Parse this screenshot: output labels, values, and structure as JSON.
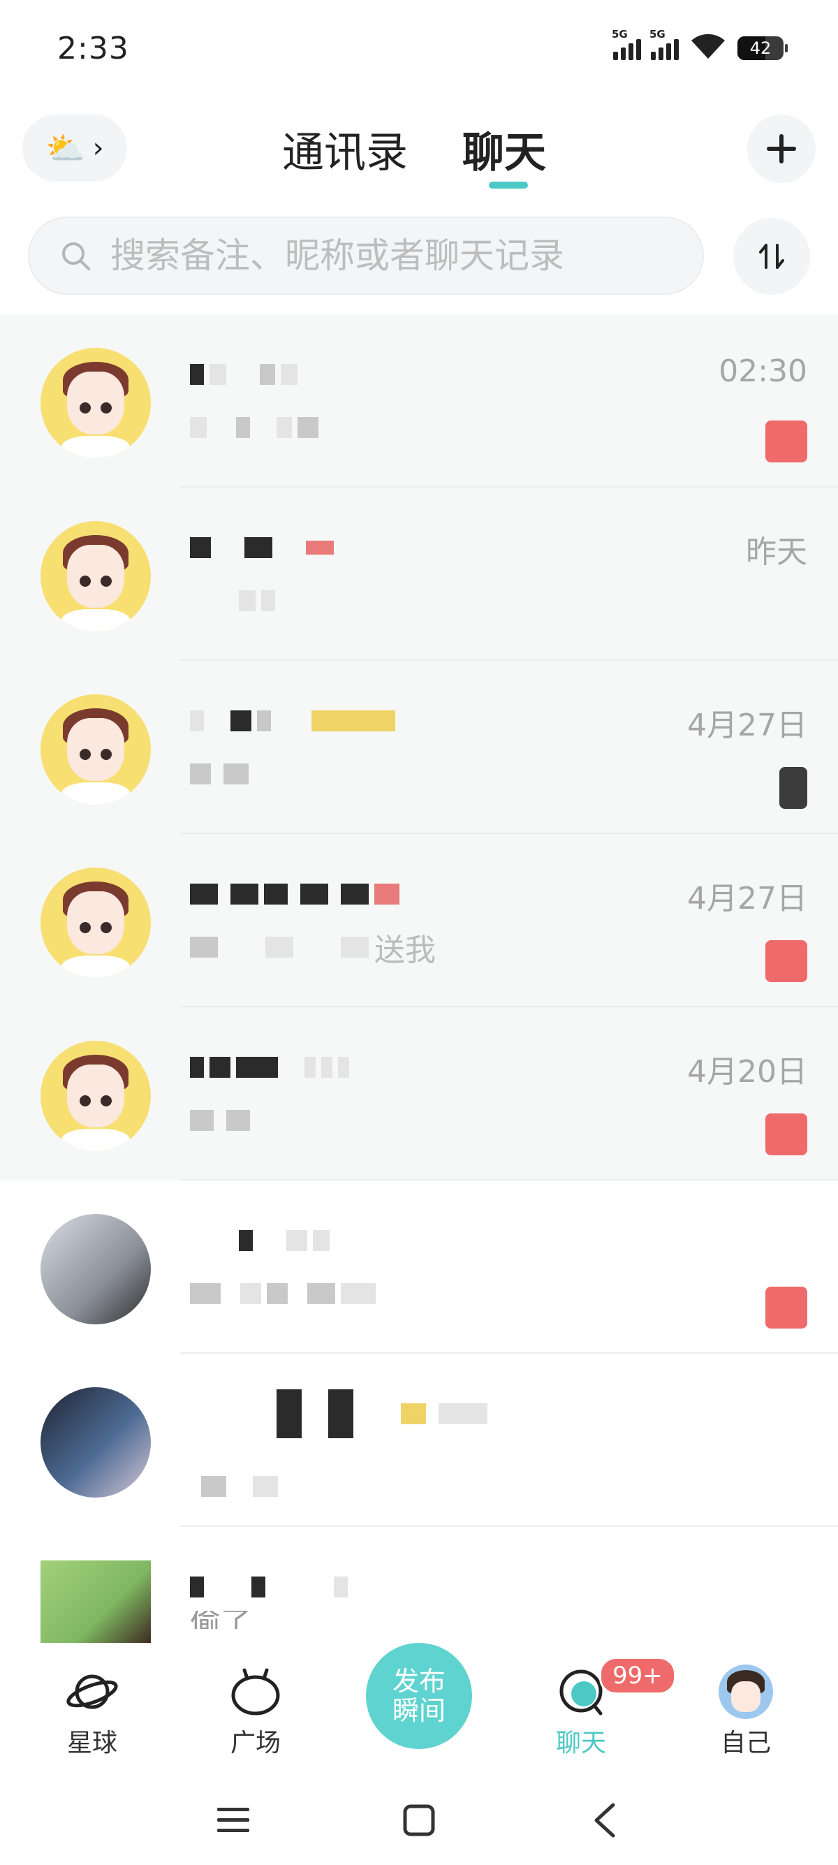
{
  "status": {
    "time": "2:33",
    "sim1": "5G",
    "sim2": "5G",
    "battery": "42"
  },
  "header": {
    "tabs": [
      {
        "label": "通讯录",
        "active": false
      },
      {
        "label": "聊天",
        "active": true
      }
    ],
    "accent_color": "#4cc9c5"
  },
  "search": {
    "placeholder": "搜索备注、昵称或者聊天记录"
  },
  "chats": [
    {
      "time": "02:30",
      "pinned": true,
      "unread": true
    },
    {
      "time": "昨天",
      "pinned": true,
      "unread": false
    },
    {
      "time": "4月27日",
      "pinned": true,
      "unread": true
    },
    {
      "time": "4月27日",
      "pinned": true,
      "unread": true,
      "preview_fragment": "送我"
    },
    {
      "time": "4月20日",
      "pinned": true,
      "unread": true
    },
    {
      "time": "",
      "pinned": false,
      "unread": true
    },
    {
      "time": "",
      "pinned": false,
      "unread": false
    },
    {
      "time": "",
      "pinned": false,
      "unread": false,
      "preview_fragment": "偷了"
    }
  ],
  "bottom_nav": {
    "planet": "星球",
    "square": "广场",
    "publish": "发布瞬间",
    "chat": "聊天",
    "chat_badge": "99+",
    "me": "自己"
  },
  "colors": {
    "unread_badge": "#ef6a6a",
    "publish_button": "#5ed3cf"
  }
}
